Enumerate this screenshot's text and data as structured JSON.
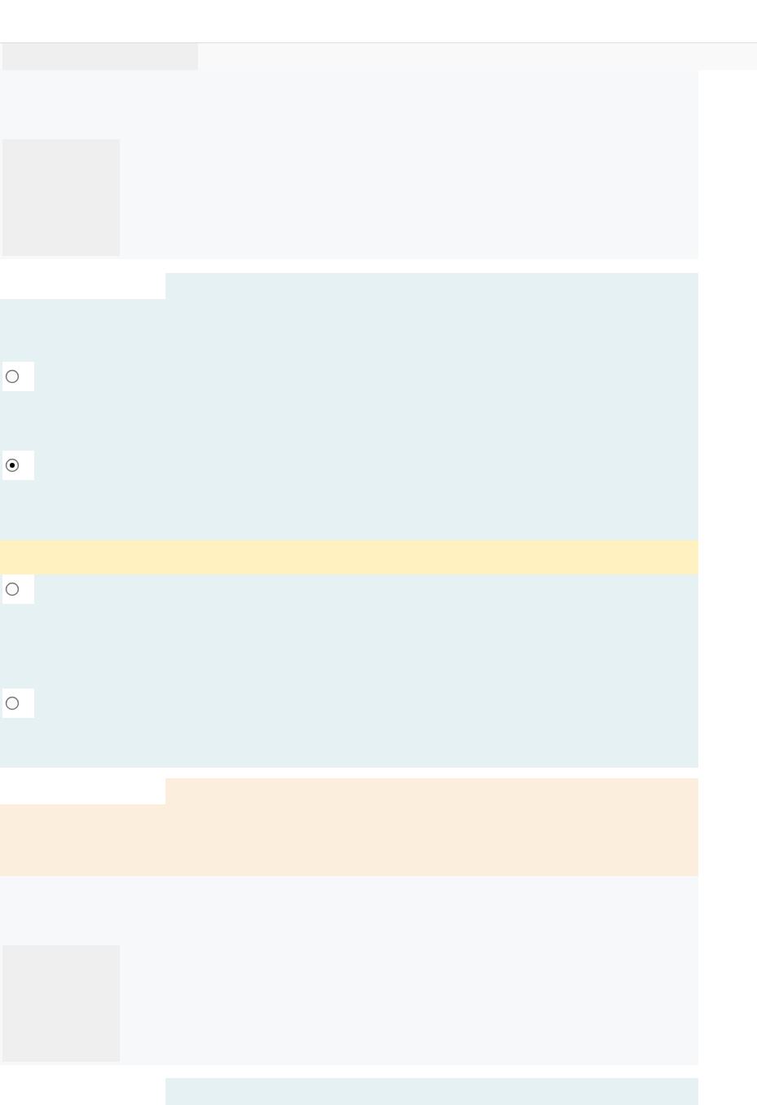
{
  "question": {
    "options": [
      {
        "selected": false
      },
      {
        "selected": true
      },
      {
        "selected": false
      },
      {
        "selected": false
      }
    ]
  }
}
